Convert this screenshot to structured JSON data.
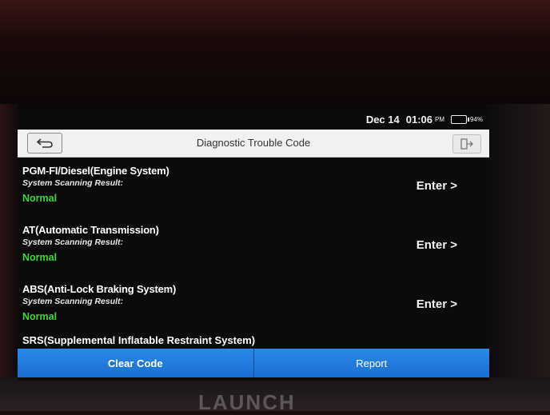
{
  "device": {
    "brand": "LAUNCH"
  },
  "status": {
    "date": "Dec 14",
    "time": "01:06",
    "ampm": "PM",
    "battery": "94%"
  },
  "header": {
    "title": "Diagnostic Trouble Code"
  },
  "systems": [
    {
      "name": "PGM-FI/Diesel(Engine System)",
      "label": "System Scanning Result:",
      "status": "Normal",
      "action": "Enter >"
    },
    {
      "name": "AT(Automatic Transmission)",
      "label": "System Scanning Result:",
      "status": "Normal",
      "action": "Enter >"
    },
    {
      "name": "ABS(Anti-Lock Braking System)",
      "label": "System Scanning Result:",
      "status": "Normal",
      "action": "Enter >"
    }
  ],
  "partial_item": "SRS(Supplemental Inflatable Restraint System)",
  "buttons": {
    "clear": "Clear Code",
    "report": "Report"
  },
  "colors": {
    "accent": "#1e7ee0",
    "normal": "#3fd43a"
  }
}
